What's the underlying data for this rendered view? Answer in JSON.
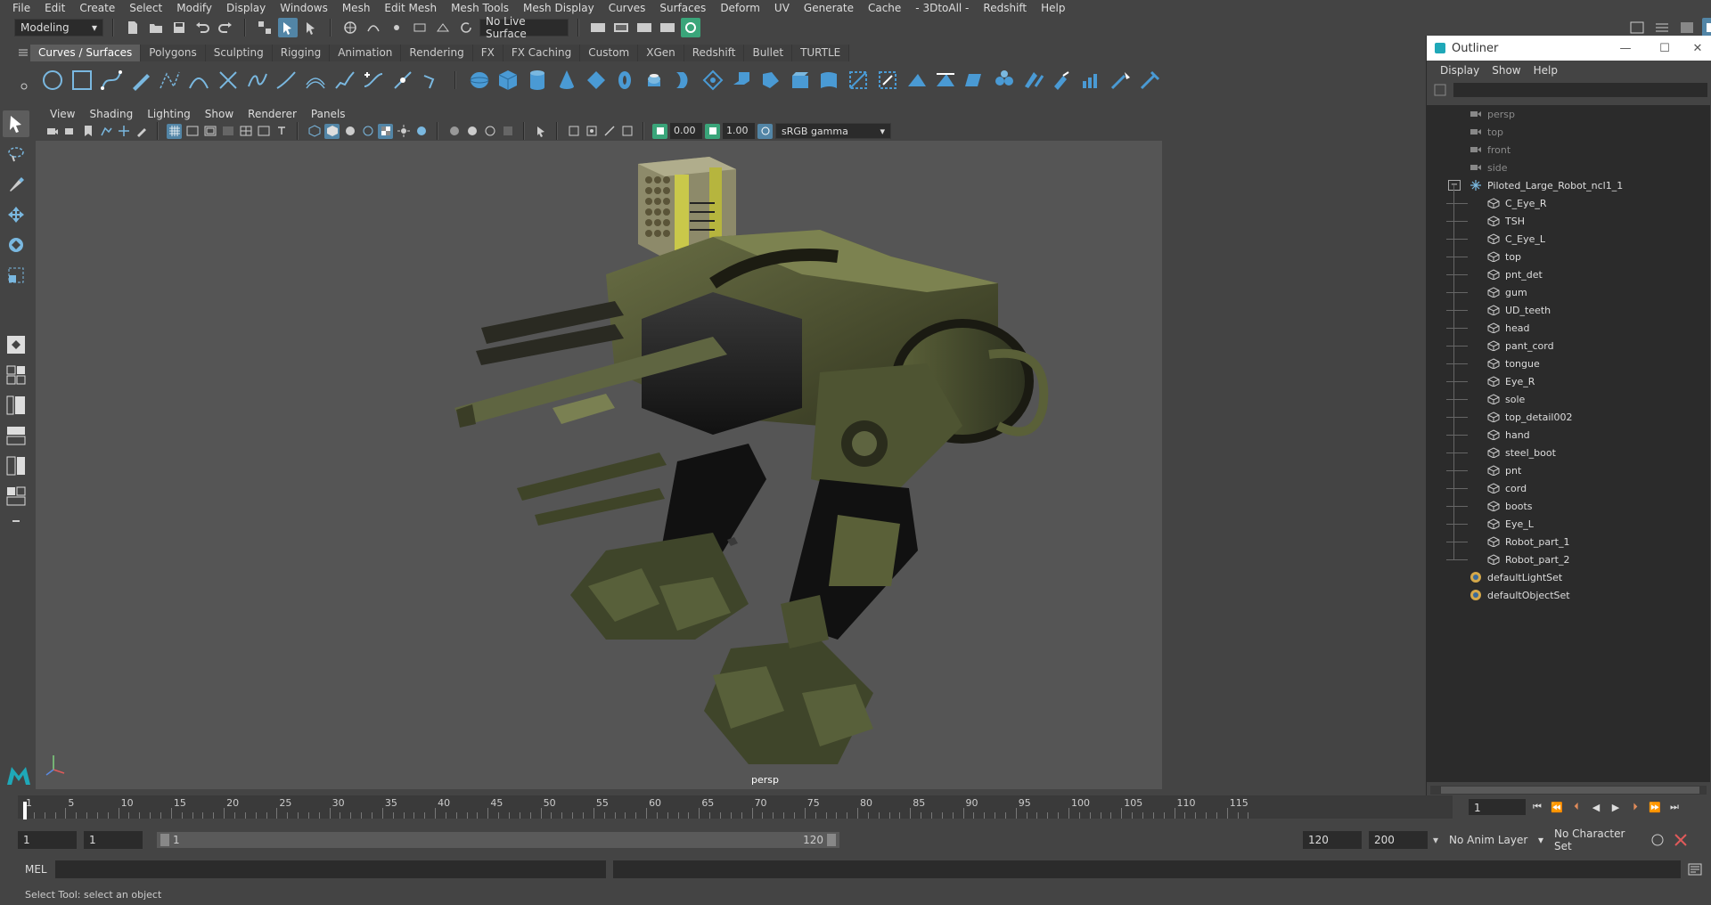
{
  "menubar": {
    "items": [
      "File",
      "Edit",
      "Create",
      "Select",
      "Modify",
      "Display",
      "Windows",
      "Mesh",
      "Edit Mesh",
      "Mesh Tools",
      "Mesh Display",
      "Curves",
      "Surfaces",
      "Deform",
      "UV",
      "Generate",
      "Cache",
      "- 3DtoAll -",
      "Redshift",
      "Help"
    ]
  },
  "statusline": {
    "mode": "Modeling",
    "live_surface": "No Live Surface"
  },
  "shelf": {
    "tabs": [
      "Curves / Surfaces",
      "Polygons",
      "Sculpting",
      "Rigging",
      "Animation",
      "Rendering",
      "FX",
      "FX Caching",
      "Custom",
      "XGen",
      "Redshift",
      "Bullet",
      "TURTLE"
    ],
    "active_tab": "Curves / Surfaces"
  },
  "viewport": {
    "menu": [
      "View",
      "Shading",
      "Lighting",
      "Show",
      "Renderer",
      "Panels"
    ],
    "exposure": "0.00",
    "gamma": "1.00",
    "color_space": "sRGB gamma",
    "camera_label": "persp"
  },
  "outliner": {
    "title": "Outliner",
    "menu": [
      "Display",
      "Show",
      "Help"
    ],
    "cameras": [
      "persp",
      "top",
      "front",
      "side"
    ],
    "group": "Piloted_Large_Robot_ncl1_1",
    "children": [
      "C_Eye_R",
      "TSH",
      "C_Eye_L",
      "top",
      "pnt_det",
      "gum",
      "UD_teeth",
      "head",
      "pant_cord",
      "tongue",
      "Eye_R",
      "sole",
      "top_detail002",
      "hand",
      "steel_boot",
      "pnt",
      "cord",
      "boots",
      "Eye_L",
      "Robot_part_1",
      "Robot_part_2"
    ],
    "sets": [
      "defaultLightSet",
      "defaultObjectSet"
    ]
  },
  "timeslider": {
    "ticks": [
      "1",
      "5",
      "10",
      "15",
      "20",
      "25",
      "30",
      "35",
      "40",
      "45",
      "50",
      "55",
      "60",
      "65",
      "70",
      "75",
      "80",
      "85",
      "90",
      "95",
      "100",
      "105",
      "110",
      "115"
    ],
    "current_frame": "1"
  },
  "rangebar": {
    "start": "1",
    "playback_start": "1",
    "range_start_label": "1",
    "range_end_label": "120",
    "playback_end": "120",
    "end": "200",
    "anim_layer": "No Anim Layer",
    "character_set": "No Character Set"
  },
  "cmdline": {
    "label": "MEL"
  },
  "helpline": {
    "text": "Select Tool: select an object"
  }
}
